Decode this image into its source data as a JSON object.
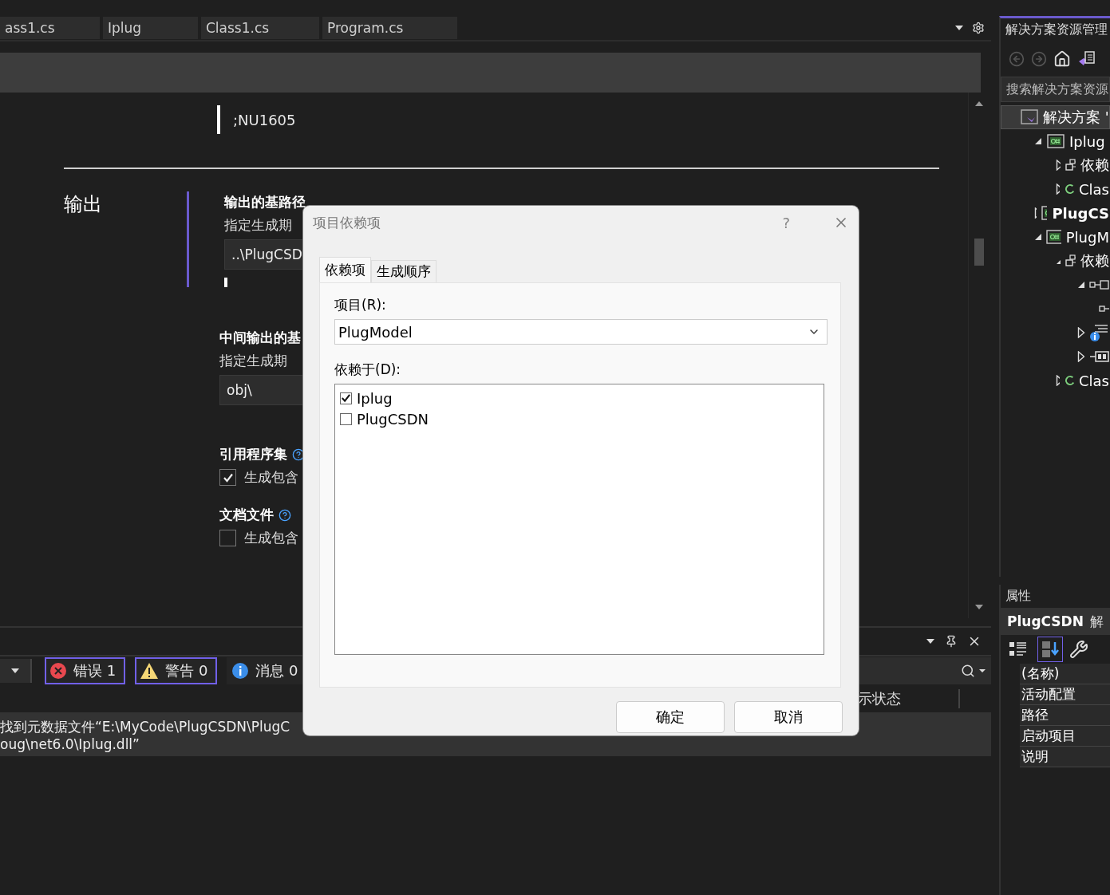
{
  "editor_tabs": [
    {
      "label": "ass1.cs"
    },
    {
      "label": "Iplug"
    },
    {
      "label": "Class1.cs"
    },
    {
      "label": "Program.cs"
    }
  ],
  "editor": {
    "suppress_value": ";NU1605",
    "section_title": "输出",
    "groups": [
      {
        "kind": "path",
        "title": "输出的基路径",
        "description": "指定生成期",
        "value": "..\\PlugCSD"
      },
      {
        "kind": "path",
        "title": "中间输出的基",
        "description": "指定生成期",
        "value": "obj\\"
      },
      {
        "kind": "checkbox",
        "title": "引用程序集",
        "label": "生成包含",
        "checked": true
      },
      {
        "kind": "checkbox",
        "title": "文档文件",
        "label": "生成包含",
        "checked": false
      }
    ]
  },
  "error_list": {
    "filters": [
      {
        "kind": "error",
        "label": "错误 1",
        "selected": true
      },
      {
        "kind": "warning",
        "label": "警告 0",
        "selected": true
      },
      {
        "kind": "info",
        "label": "消息 0",
        "selected": false
      }
    ],
    "column_header": "示状态",
    "message_lines": [
      "找到元数据文件“E:\\MyCode\\PlugCSDN\\PlugC",
      "oug\\net6.0\\Iplug.dll”"
    ]
  },
  "solution_explorer": {
    "title": "解决方案资源管理",
    "search_placeholder": "搜索解决方案资源",
    "tree": [
      {
        "label": "解决方案 '",
        "kind": "solution",
        "selected": true,
        "children": [
          {
            "label": "Iplug",
            "kind": "project",
            "expanded": true,
            "selected": false,
            "children": [
              {
                "label": "依赖",
                "kind": "dependencies",
                "expanded": false,
                "selected": false
              },
              {
                "label": "Clas",
                "kind": "csharp",
                "expanded": false,
                "selected": false
              }
            ]
          },
          {
            "label": "PlugCS",
            "kind": "project",
            "expanded": false,
            "bold": true,
            "selected": false
          },
          {
            "label": "PlugM",
            "kind": "project",
            "expanded": true,
            "selected": false,
            "children": [
              {
                "label": "依赖",
                "kind": "dependencies",
                "expanded": true,
                "selected": false,
                "children": [
                  {
                    "kind": "package",
                    "expanded": true,
                    "selected": false,
                    "children": [
                      {
                        "kind": "package",
                        "selected": false
                      }
                    ]
                  },
                  {
                    "kind": "analyzer",
                    "expanded": false,
                    "selected": false
                  },
                  {
                    "kind": "framework",
                    "expanded": false,
                    "selected": false
                  }
                ]
              },
              {
                "label": "Clas",
                "kind": "csharp",
                "expanded": false,
                "selected": false
              }
            ]
          }
        ]
      }
    ]
  },
  "properties": {
    "title": "属性",
    "object_name": "PlugCSDN",
    "object_type": "解",
    "rows": [
      "(名称)",
      "活动配置",
      "路径",
      "启动项目",
      "说明"
    ]
  },
  "dialog": {
    "title": "项目依赖项",
    "help_button": "?",
    "tabs": [
      {
        "label": "依赖项",
        "selected": true
      },
      {
        "label": "生成顺序",
        "selected": false
      }
    ],
    "project_label": "项目(R):",
    "project_value": "PlugModel",
    "depends_label": "依赖于(D):",
    "projects": [
      {
        "label": "Iplug",
        "checked": true
      },
      {
        "label": "PlugCSDN",
        "checked": false
      }
    ],
    "buttons": [
      "确定",
      "取消"
    ]
  }
}
